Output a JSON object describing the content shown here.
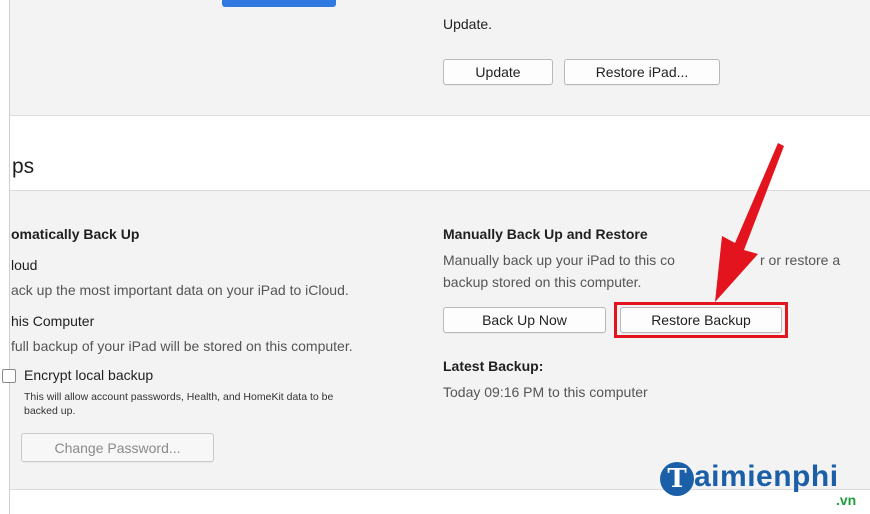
{
  "top_section": {
    "update_text": "Update.",
    "update_button": "Update",
    "restore_ipad_button": "Restore iPad..."
  },
  "backups": {
    "heading": "ps",
    "auto": {
      "heading": "omatically Back Up",
      "icloud_label": "loud",
      "icloud_desc": "ack up the most important data on your iPad to iCloud.",
      "computer_label": "his Computer",
      "computer_desc": "full backup of your iPad will be stored on this computer.",
      "encrypt_label": "Encrypt local backup",
      "encrypt_desc_1": "This will allow account passwords, Health, and HomeKit data to be",
      "encrypt_desc_2": "backed up.",
      "change_password_button": "Change Password..."
    },
    "manual": {
      "heading": "Manually Back Up and Restore",
      "desc_1": "Manually back up your iPad to this co",
      "desc_1b": "r or restore a",
      "desc_2": "backup stored on this computer.",
      "back_up_now_button": "Back Up Now",
      "restore_backup_button": "Restore Backup",
      "latest_backup_label": "Latest Backup:",
      "latest_backup_value": "Today 09:16 PM to this computer"
    }
  },
  "watermark": {
    "logo_letter": "T",
    "logo_text": "aimienphi",
    "logo_suffix": ".vn"
  },
  "colors": {
    "accent_tab": "#2f79e0",
    "highlight_red": "#e3141d",
    "logo_blue": "#1a5fa8"
  }
}
